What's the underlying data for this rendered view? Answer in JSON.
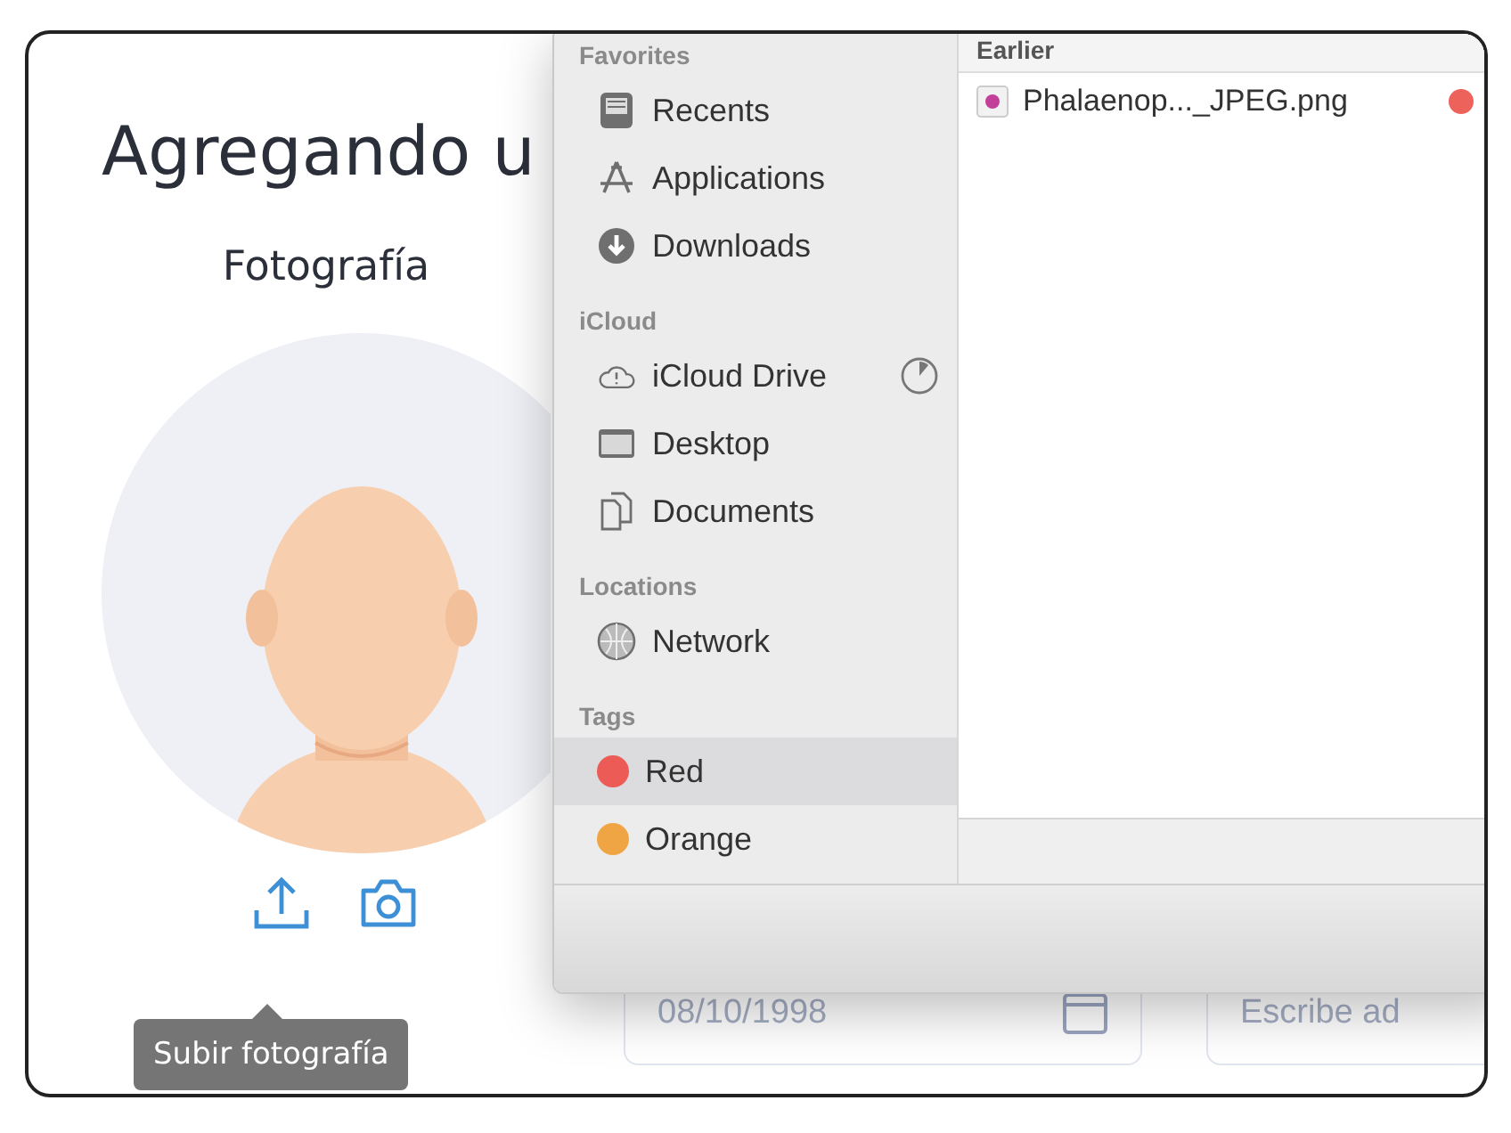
{
  "page": {
    "heading": "Agregando u",
    "photo_label": "Fotografía",
    "tooltip": "Subir fotografía",
    "date_field": {
      "value": "08/10/1998"
    },
    "text_field": {
      "placeholder": "Escribe ad"
    }
  },
  "file_dialog": {
    "sidebar": [
      {
        "heading": "Favorites",
        "items": [
          {
            "label": "Recents",
            "kind": "recents",
            "selected": false
          },
          {
            "label": "Applications",
            "kind": "applications",
            "selected": false
          },
          {
            "label": "Downloads",
            "kind": "downloads",
            "selected": false
          }
        ]
      },
      {
        "heading": "iCloud",
        "items": [
          {
            "label": "iCloud Drive",
            "kind": "cloud",
            "selected": false
          },
          {
            "label": "Desktop",
            "kind": "desktop",
            "selected": false
          },
          {
            "label": "Documents",
            "kind": "documents",
            "selected": false
          }
        ]
      },
      {
        "heading": "Locations",
        "items": [
          {
            "label": "Network",
            "kind": "network",
            "selected": false
          }
        ]
      },
      {
        "heading": "Tags",
        "items": [
          {
            "label": "Red",
            "kind": "tag",
            "color": "#ec5b55",
            "selected": true
          },
          {
            "label": "Orange",
            "kind": "tag",
            "color": "#f0a545",
            "selected": false
          }
        ]
      }
    ],
    "list_header": "Earlier",
    "files": [
      {
        "name": "Phalaenop..._JPEG.png",
        "color": "#ee625c"
      }
    ]
  }
}
